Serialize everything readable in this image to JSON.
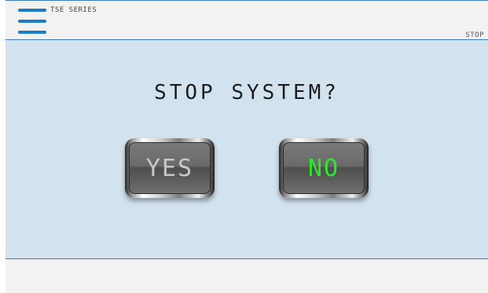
{
  "header": {
    "series_label": "TSE SERIES",
    "status_label": "STOP"
  },
  "dialog": {
    "prompt": "STOP SYSTEM?",
    "yes_label": "YES",
    "no_label": "NO"
  },
  "colors": {
    "panel_background": "#d3e2ef",
    "accent_blue": "#1e7bc4",
    "no_label_green": "#2ee82e",
    "yes_label_gray": "#c8c8c8"
  },
  "icons": {
    "menu": "hamburger-menu-icon"
  }
}
